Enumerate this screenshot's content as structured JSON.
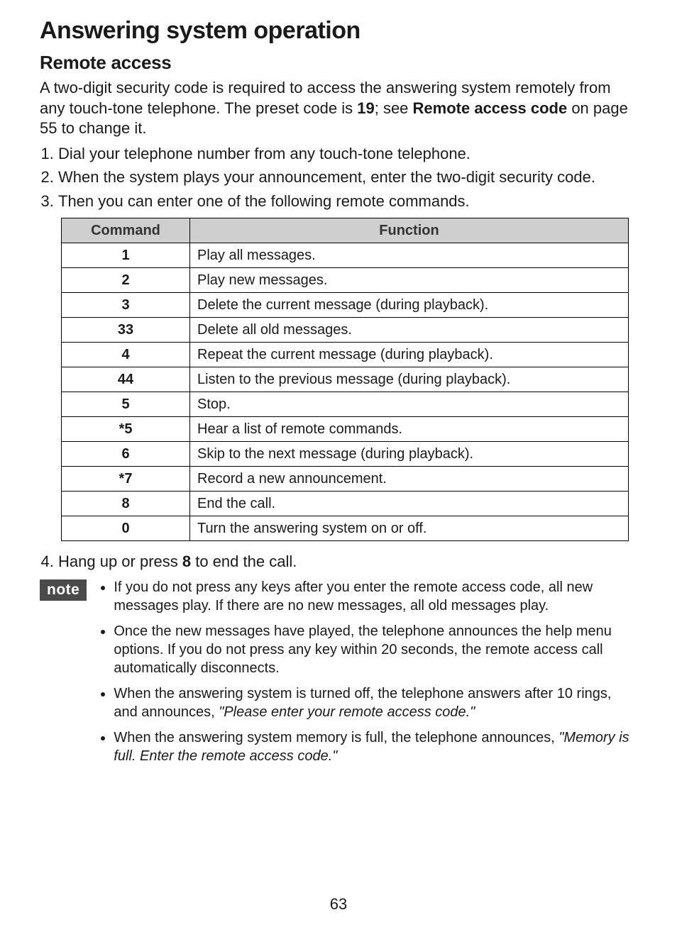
{
  "title": "Answering system operation",
  "subtitle": "Remote access",
  "intro_parts": {
    "pre": "A two-digit security code is required to access the answering system remotely from any touch-tone telephone. The preset code is ",
    "code": "19",
    "mid": "; see ",
    "link": "Remote access code",
    "post": " on page 55 to change it."
  },
  "steps": [
    "Dial your telephone number from any touch-tone telephone.",
    "When the system plays your announcement, enter the two-digit security code.",
    "Then you can enter one of the following remote commands."
  ],
  "table": {
    "headers": {
      "command": "Command",
      "function": "Function"
    },
    "rows": [
      {
        "command": "1",
        "function": "Play all messages."
      },
      {
        "command": "2",
        "function": "Play new messages."
      },
      {
        "command": "3",
        "function": "Delete the current message (during playback)."
      },
      {
        "command": "33",
        "function": "Delete all old messages."
      },
      {
        "command": "4",
        "function": "Repeat the current message (during playback)."
      },
      {
        "command": "44",
        "function": "Listen to the previous message (during playback)."
      },
      {
        "command": "5",
        "function": "Stop."
      },
      {
        "command": "*5",
        "function": "Hear a list of remote commands."
      },
      {
        "command": "6",
        "function": "Skip to the next message (during playback)."
      },
      {
        "command": "*7",
        "function": "Record a new announcement."
      },
      {
        "command": "8",
        "function": "End the call."
      },
      {
        "command": "0",
        "function": "Turn the answering system on or off."
      }
    ]
  },
  "step4": {
    "pre": "Hang up or press ",
    "key": "8",
    "post": " to end the call."
  },
  "note_label": "note",
  "notes": [
    {
      "plain": "If you do not press any keys after you enter the remote access code, all new messages play. If there are no new messages, all old messages play."
    },
    {
      "plain": "Once the new messages have played, the telephone announces the help menu options. If you do not press any key within 20 seconds, the remote access call automatically disconnects."
    },
    {
      "plain": "When the answering system is turned off, the telephone answers after 10 rings, and announces, ",
      "italic": "\"Please enter your remote access code.\""
    },
    {
      "plain": "When the answering system memory is full, the telephone announces, ",
      "italic": "\"Memory is full. Enter the remote access code.\""
    }
  ],
  "page_number": "63"
}
